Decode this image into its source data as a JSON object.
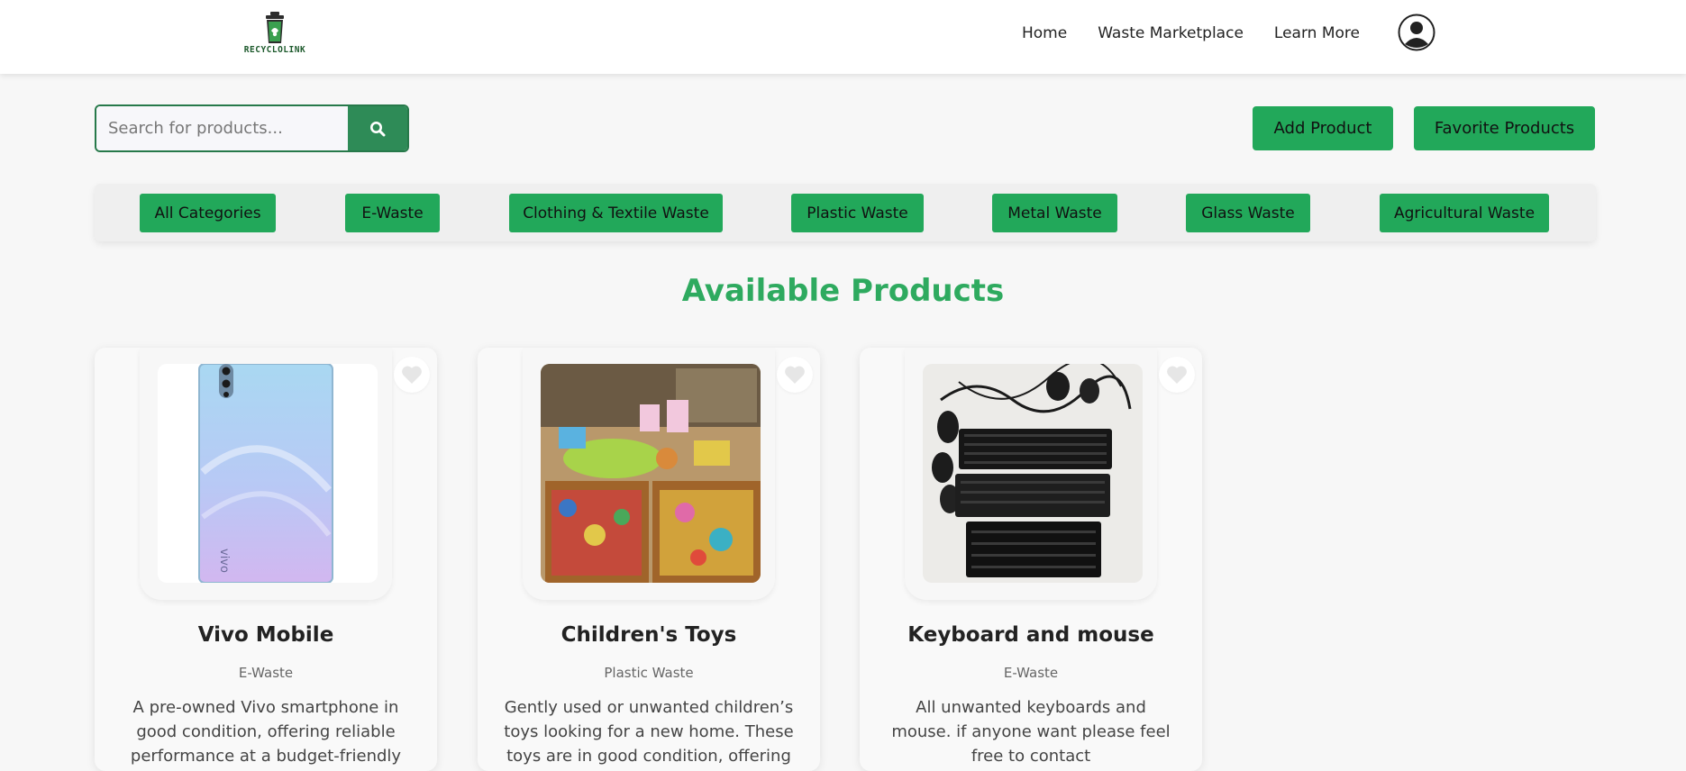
{
  "brand": {
    "logo_text": "RECYCLOLINK"
  },
  "nav": {
    "links": [
      "Home",
      "Waste Marketplace",
      "Learn More"
    ]
  },
  "search": {
    "placeholder": "Search for products..."
  },
  "actions": {
    "add_product": "Add Product",
    "favorites": "Favorite Products"
  },
  "categories": [
    "All Categories",
    "E-Waste",
    "Clothing & Textile Waste",
    "Plastic Waste",
    "Metal Waste",
    "Glass Waste",
    "Agricultural Waste"
  ],
  "section_title": "Available Products",
  "products": [
    {
      "title": "Vivo Mobile",
      "category": "E-Waste",
      "description": "A pre-owned Vivo smartphone in good condition, offering reliable performance at a budget-friendly",
      "image": "phone-image"
    },
    {
      "title": "Children's Toys",
      "category": "Plastic Waste",
      "description": "Gently used or unwanted children’s toys looking for a new home. These toys are in good condition, offering",
      "image": "toys-image"
    },
    {
      "title": "Keyboard and mouse",
      "category": "E-Waste",
      "description": "All unwanted keyboards and mouse. if anyone want please feel free to contact",
      "image": "keyboards-image"
    }
  ],
  "colors": {
    "accent": "#22a85a",
    "title_green": "#2eaa5f",
    "search_green": "#2e8b57",
    "background": "#f7f7f7"
  },
  "icons": {
    "search": "magnifier-icon",
    "profile": "user-circle-icon",
    "favorite": "heart-icon"
  }
}
